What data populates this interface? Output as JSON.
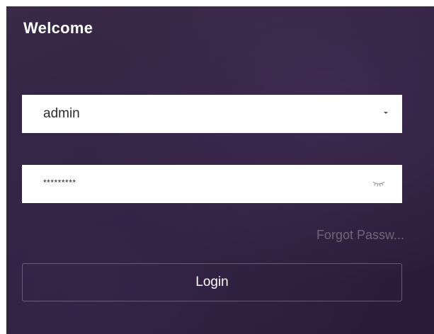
{
  "login_panel": {
    "title": "Welcome",
    "username": {
      "value": "admin",
      "dropdown_icon": "chevron-down-icon"
    },
    "password": {
      "masked_value": "*********",
      "visibility_icon": "eye-closed-icon"
    },
    "forgot_password_label": "Forgot Passw...",
    "login_label": "Login"
  },
  "colors": {
    "panel_background": "#2f2140",
    "field_background": "#ffffff",
    "title_text": "#ffffff",
    "link_text": "#6f6478",
    "button_border": "#6a5c76"
  }
}
